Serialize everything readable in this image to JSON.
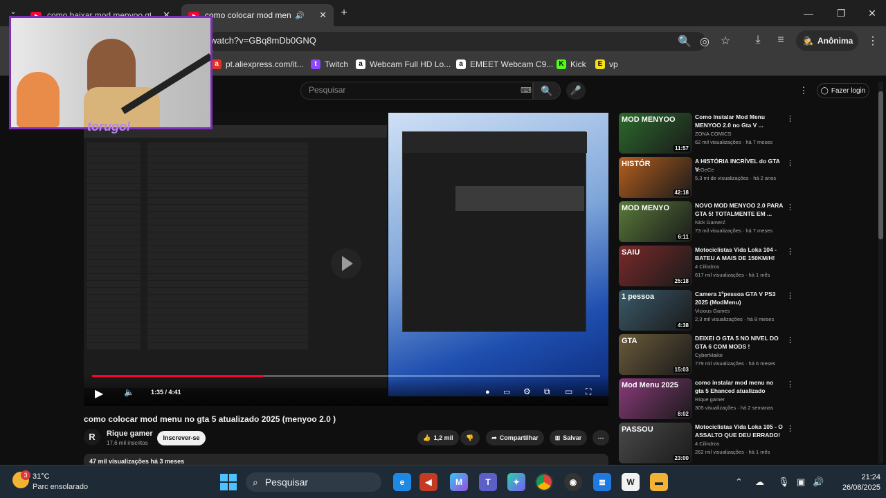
{
  "tabs": [
    {
      "label": "como baixar mod menyoo gta"
    },
    {
      "label": "como colocar mod menu no"
    }
  ],
  "address": {
    "url": "watch?v=GBq8mDb0GNQ",
    "profile": "Anônima"
  },
  "bookmarks": [
    {
      "label": "pt.aliexpress.com/it..."
    },
    {
      "label": "Twitch"
    },
    {
      "label": "Webcam Full HD Lo..."
    },
    {
      "label": "EMEET Webcam C9..."
    },
    {
      "label": "Kick"
    },
    {
      "label": "vp"
    }
  ],
  "youtube": {
    "search_placeholder": "Pesquisar",
    "login_label": "Fazer login"
  },
  "player": {
    "time": "1:35 / 4:41",
    "progress_fraction": 0.338
  },
  "video": {
    "title": "como colocar mod menu no gta 5 atualizado 2025 (menyoo 2.0 )",
    "channel": "Rique gamer",
    "subscribers": "17,6 mil inscritos",
    "subscribe_label": "Inscrever-se",
    "likes": "1,2 mil",
    "share_label": "Compartilhar",
    "save_label": "Salvar",
    "stats": "47 mil visualizações  há 3 meses"
  },
  "recommendations": [
    {
      "title": "Como Instalar Mod Menu MENYOO 2.0 no Gta V ...",
      "channel": "ZONA COMICS",
      "meta": "62 mil visualizações · há 7 meses",
      "duration": "11:57",
      "thumb_text": "MOD MENYOO",
      "color": "#2c6a2c"
    },
    {
      "title": "A HISTÓRIA INCRÍVEL do GTA V",
      "channel": "TeGeCe",
      "meta": "5,3 mi de visualizações · há 2 anos",
      "duration": "42:18",
      "thumb_text": "HISTÓR",
      "color": "#b55f1e"
    },
    {
      "title": "NOVO MOD MENYOO 2.0 PARA GTA 5! TOTALMENTE EM ...",
      "channel": "Nick GamerZ",
      "meta": "73 mil visualizações · há 7 meses",
      "duration": "6:11",
      "thumb_text": "MOD MENYO",
      "color": "#5a7a3a"
    },
    {
      "title": "Motociclistas Vida Loka 104 - BATEU A MAIS DE 150KM/H!",
      "channel": "4 Cilindros",
      "meta": "617 mil visualizações · há 1 mês",
      "duration": "25:18",
      "thumb_text": "SAIU",
      "color": "#7a2a2a"
    },
    {
      "title": "Camera 1ºpessoa GTA V PS3 2025 (ModMenu)",
      "channel": "Vicious Games",
      "meta": "2,3 mil visualizações · há 8 meses",
      "duration": "4:38",
      "thumb_text": "1 pessoa",
      "color": "#3a5a6a"
    },
    {
      "title": "DEIXEI O GTA 5 NO NIVEL DO GTA 6 COM MODS !",
      "channel": "CyberMaike",
      "meta": "779 mil visualizações · há 6 meses",
      "duration": "15:03",
      "thumb_text": "GTA",
      "color": "#6a5a3a"
    },
    {
      "title": "como instalar mod menu no gta 5 Ehanced atualizado",
      "channel": "Rique gamer",
      "meta": "305 visualizações · há 2 semanas",
      "duration": "8:02",
      "thumb_text": "Mod Menu 2025",
      "color": "#8a3a7a"
    },
    {
      "title": "Motociclistas Vida Loka 105 - O ASSALTO QUE DEU ERRADO!",
      "channel": "4 Cilindros",
      "meta": "262 mil visualizações · há 1 mês",
      "duration": "23:00",
      "thumb_text": "PASSOU",
      "color": "#4a4a4a"
    }
  ],
  "overlay": {
    "streamer": "torugol"
  },
  "taskbar": {
    "temperature": "31°C",
    "weather": "Parc ensolarado",
    "badge": "3",
    "search_label": "Pesquisar",
    "time": "21:24",
    "date": "26/08/2025"
  }
}
